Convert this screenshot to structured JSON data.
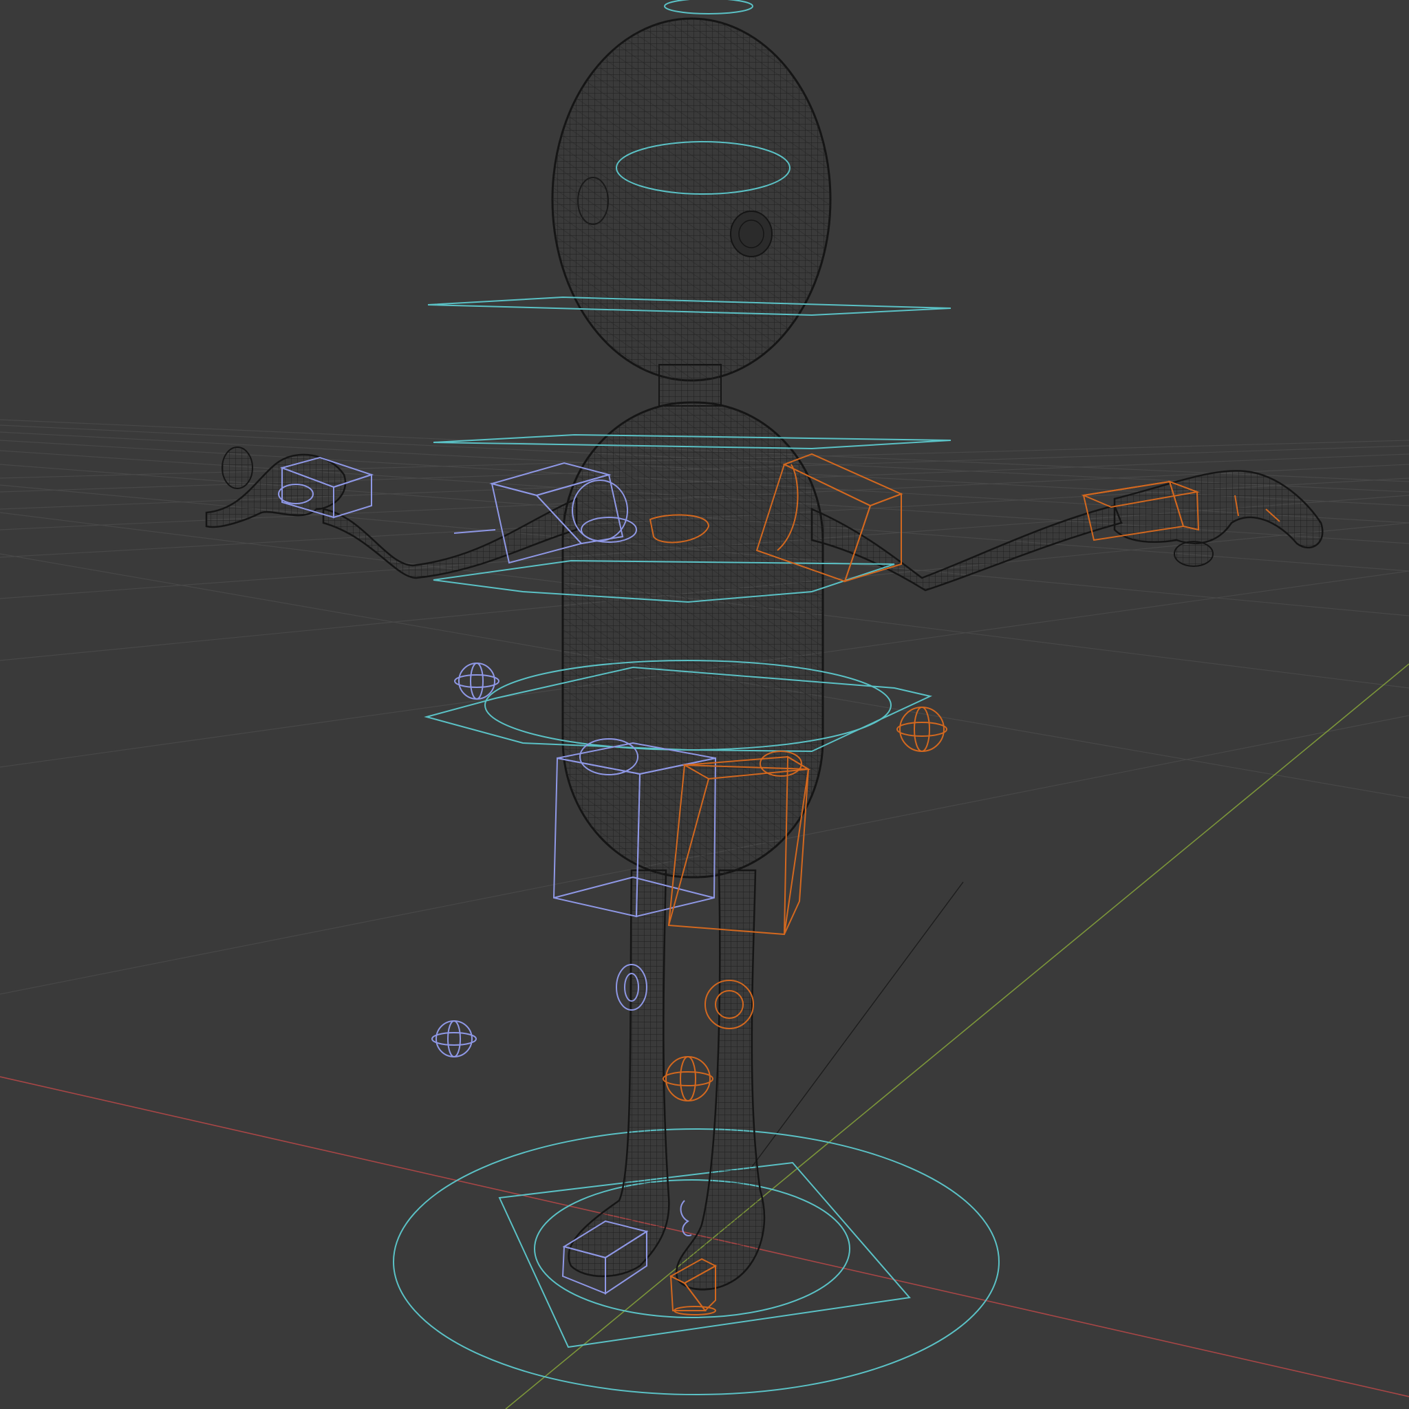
{
  "viewport": {
    "mode": "wireframe",
    "background_color": "#3a3a3a"
  },
  "colors": {
    "grid": "#4a4a4a",
    "axis_x": "#b44a4a",
    "axis_y": "#7e9a3a",
    "axis_z": "#222222",
    "mesh": "#1c1c1c",
    "control_center": "#5bc2c6",
    "control_left": "#8f98e6",
    "control_right": "#d3681f"
  },
  "scene_objects": {
    "character_mesh": "wireframe-character",
    "armature_controls": {
      "center": [
        "head-top-ring",
        "head-ring",
        "neck-ring",
        "chest-ring",
        "waist-ring",
        "hip-ring",
        "root-circle"
      ],
      "left": [
        "hand-ik-box",
        "upper-arm-box",
        "hip-box",
        "knee-pole",
        "leg-pole-sphere",
        "elbow-pole-sphere",
        "foot-ik-box"
      ],
      "right": [
        "hand-ik-box",
        "upper-arm-box",
        "hip-box",
        "knee-pole",
        "leg-pole-sphere",
        "elbow-pole-sphere",
        "foot-ik-box"
      ]
    }
  }
}
